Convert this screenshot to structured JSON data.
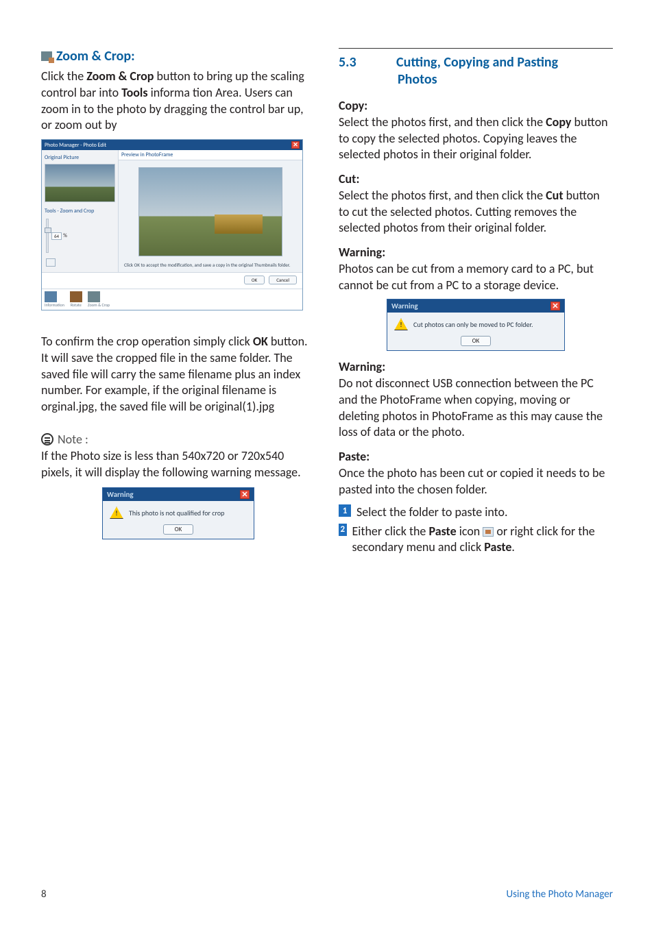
{
  "left": {
    "zoom": {
      "title": "Zoom & Crop:",
      "p1a": "Click the ",
      "p1b": " button to bring up the scaling control bar into ",
      "p1c": " informa tion Area. Users can zoom in to the photo by dragging the control bar up, or zoom out by",
      "zoom_label": "Zoom & Crop",
      "tools_label": "Tools"
    },
    "pm": {
      "title": "Photo Manager - Photo Edit",
      "original": "Original Picture",
      "tools": "Tools - Zoom and Crop",
      "zoom_value": "64",
      "zoom_pct": "%",
      "preview": "Preview in PhotoFrame",
      "hint": "Click OK to accept the modification, and save a copy in the original Thumbnails folder.",
      "ok": "OK",
      "cancel": "Cancel",
      "f_info": "Information",
      "f_rotate": "Rotate",
      "f_zoom": "Zoom & Crop"
    },
    "confirm": {
      "p_a": "To confirm the crop operation simply click ",
      "p_b": " button. It will save the cropped file in the same folder. The saved file will carry the same filename plus an index number. For example, if the original filename is orginal.jpg, the saved file will be original(1).jpg",
      "ok": "OK"
    },
    "note": {
      "label": "Note :",
      "text": "If the Photo size is less than 540x720 or 720x540 pixels, it will display the following warning message."
    },
    "warn1": {
      "title": "Warning",
      "text": "This photo is not qualified for crop",
      "ok": "OK"
    }
  },
  "right": {
    "section": {
      "num": "5.3",
      "title_l1": "Cutting, Copying and Pasting",
      "title_l2": "Photos"
    },
    "copy": {
      "h": "Copy",
      "p_a": "Select the photos first, and then click the ",
      "p_b": " button to copy the selected photos. Copying leaves the selected photos in their original folder.",
      "bold": "Copy"
    },
    "cut": {
      "h": "Cut",
      "p_a": "Select the photos first, and then click the ",
      "p_b": " button to cut the selected photos. Cutting removes the selected photos from their original folder.",
      "bold": "Cut"
    },
    "warn": {
      "h": "Warning",
      "p": "Photos can be cut from a memory card to a PC, but cannot be cut from a PC to a storage device."
    },
    "warn_dialog": {
      "title": "Warning",
      "text": "Cut photos can only be moved to PC folder.",
      "ok": "OK"
    },
    "warn2": {
      "h": "Warning:",
      "p": "Do not disconnect USB connection between the PC and the PhotoFrame when copying, moving or deleting photos in PhotoFrame as this may cause the loss of data or the photo."
    },
    "paste": {
      "h": "Paste",
      "p": "Once the photo has been cut or copied it needs to be pasted into the chosen folder.",
      "step1": "Select the folder to paste into.",
      "step2_a": "Either click the ",
      "step2_bold1": "Paste",
      "step2_b": " icon ",
      "step2_c": " or right click for the secondary menu and click ",
      "step2_bold2": "Paste",
      "step2_d": "."
    }
  },
  "footer": {
    "page": "8",
    "section": "Using the Photo Manager"
  }
}
